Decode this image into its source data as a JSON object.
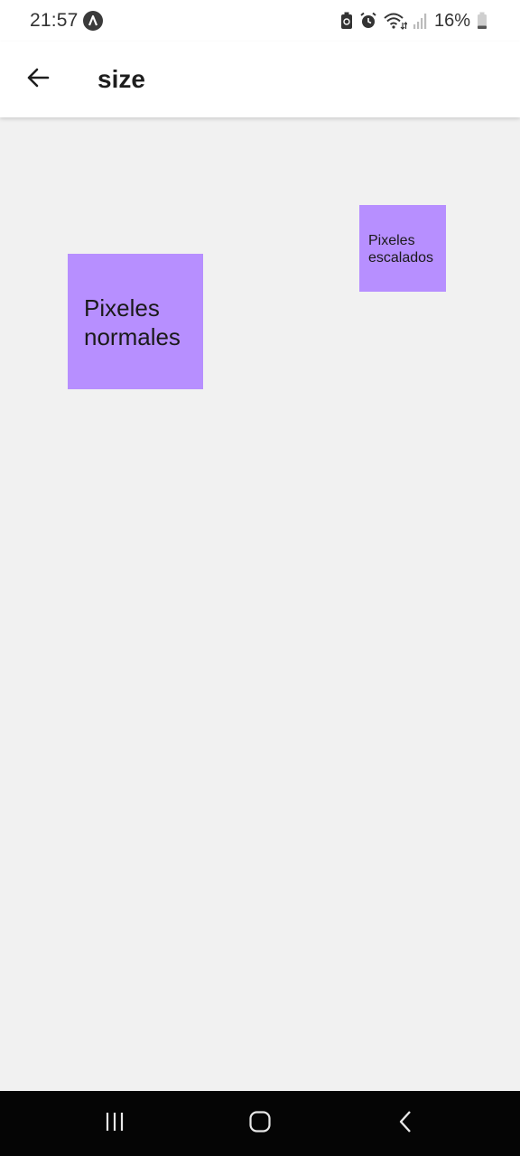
{
  "status_bar": {
    "time": "21:57",
    "battery_percent": "16%",
    "icons": [
      "app-notification-icon",
      "battery-saver-icon",
      "alarm-icon",
      "wifi-icon",
      "signal-icon",
      "battery-icon"
    ]
  },
  "app_bar": {
    "title": "size",
    "back_icon": "arrow-back-icon"
  },
  "content": {
    "normal_box": {
      "line1": "Pixeles",
      "line2": "normales",
      "color": "#b78fff"
    },
    "scaled_box": {
      "line1": "Pixeles",
      "line2": "escalados",
      "color": "#b78fff"
    }
  },
  "nav_bar": {
    "buttons": [
      "recents-icon",
      "home-icon",
      "back-icon"
    ]
  }
}
